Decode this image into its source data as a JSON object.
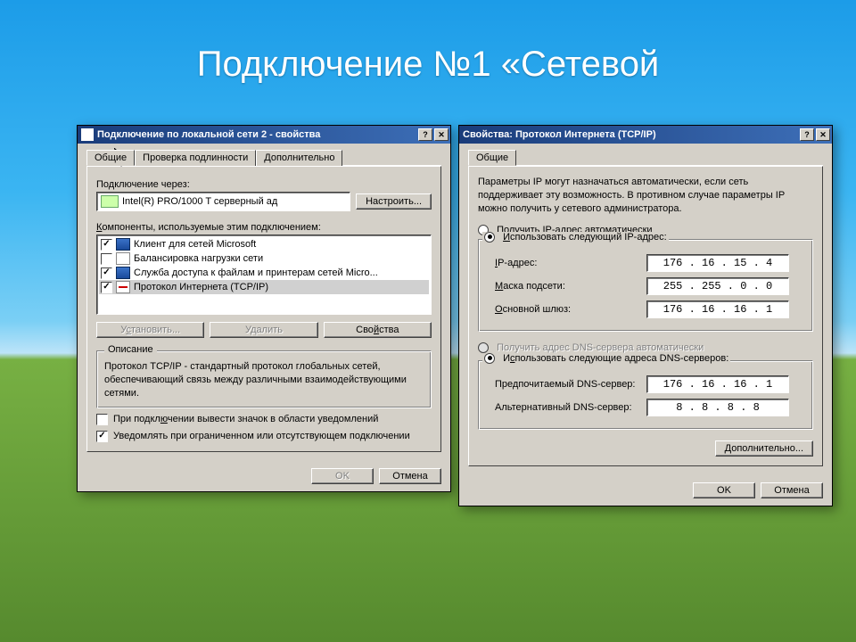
{
  "slide": {
    "title": "Подключение №1 «Сетевой"
  },
  "left": {
    "title": "Подключение по локальной сети 2 - свойства",
    "tabs": [
      "Общие",
      "Проверка подлинности",
      "Дополнительно"
    ],
    "connect_via": "Подключение через:",
    "adapter": "Intel(R) PRO/1000 T серверный ад",
    "configure": "Настроить...",
    "components_label": "Компоненты, используемые этим подключением:",
    "components": [
      {
        "checked": true,
        "label": "Клиент для сетей Microsoft",
        "icon": "net"
      },
      {
        "checked": false,
        "label": "Балансировка нагрузки сети",
        "icon": "bal"
      },
      {
        "checked": true,
        "label": "Служба доступа к файлам и принтерам сетей Micro...",
        "icon": "share"
      },
      {
        "checked": true,
        "label": "Протокол Интернета (TCP/IP)",
        "icon": "tcp",
        "selected": true
      }
    ],
    "install": "Установить...",
    "remove": "Удалить",
    "properties": "Свойства",
    "desc_title": "Описание",
    "desc_text": "Протокол TCP/IP - стандартный протокол глобальных сетей, обеспечивающий связь между различными взаимодействующими сетями.",
    "tray_label": "При подключении вывести значок в области уведомлений",
    "notify_label": "Уведомлять при ограниченном или отсутствующем подключении",
    "ok": "OK",
    "cancel": "Отмена"
  },
  "right": {
    "title": "Свойства: Протокол Интернета (TCP/IP)",
    "tab": "Общие",
    "info": "Параметры IP могут назначаться автоматически, если сеть поддерживает эту возможность. В противном случае параметры IP можно получить у сетевого администратора.",
    "radio_auto_ip": "Получить IP-адрес автоматически",
    "radio_manual_ip": "Использовать следующий IP-адрес:",
    "ip_label": "IP-адрес:",
    "ip": "176 . 16 . 15 . 4",
    "mask_label": "Маска подсети:",
    "mask": "255 . 255 . 0 . 0",
    "gw_label": "Основной шлюз:",
    "gw": "176 . 16 . 16 . 1",
    "radio_auto_dns": "Получить адрес DNS-сервера автоматически",
    "radio_manual_dns": "Использовать следующие адреса DNS-серверов:",
    "dns1_label": "Предпочитаемый DNS-сервер:",
    "dns1": "176 . 16 . 16 . 1",
    "dns2_label": "Альтернативный DNS-сервер:",
    "dns2": "8 . 8 . 8 . 8",
    "advanced": "Дополнительно...",
    "ok": "OK",
    "cancel": "Отмена"
  }
}
